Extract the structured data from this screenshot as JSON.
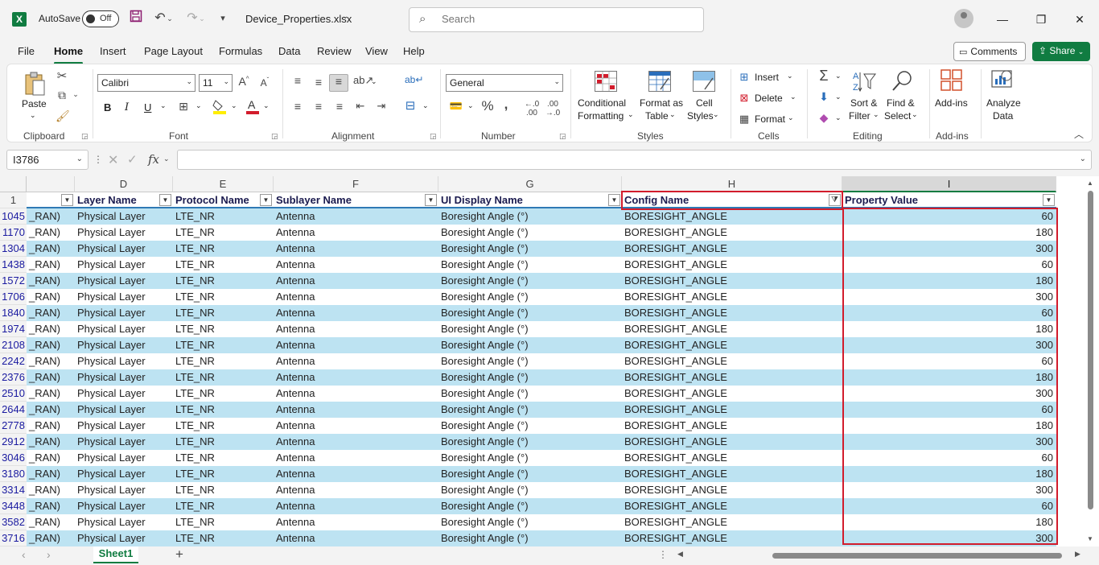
{
  "titlebar": {
    "app_logo": "X",
    "autosave_label": "AutoSave",
    "autosave_state": "Off",
    "filename": "Device_Properties.xlsx",
    "search_placeholder": "Search",
    "icons": [
      "save-icon",
      "undo-icon",
      "redo-icon",
      "customize-qat-icon",
      "account-icon",
      "minimize-icon",
      "maximize-icon",
      "close-icon"
    ]
  },
  "menu": {
    "tabs": [
      "File",
      "Home",
      "Insert",
      "Page Layout",
      "Formulas",
      "Data",
      "Review",
      "View",
      "Help"
    ],
    "active_tab": "Home",
    "comments_label": "Comments",
    "share_label": "Share"
  },
  "ribbon": {
    "clipboard": {
      "paste": "Paste",
      "label": "Clipboard"
    },
    "font": {
      "name": "Calibri",
      "size": "11",
      "label": "Font",
      "bold": "B",
      "italic": "I",
      "underline": "U"
    },
    "alignment": {
      "label": "Alignment"
    },
    "number": {
      "format": "General",
      "label": "Number"
    },
    "styles": {
      "cond1": "Conditional",
      "cond2": "Formatting",
      "fmt1": "Format as",
      "fmt2": "Table",
      "cell1": "Cell",
      "cell2": "Styles",
      "label": "Styles"
    },
    "cells": {
      "insert": "Insert",
      "delete": "Delete",
      "format": "Format",
      "label": "Cells"
    },
    "editing": {
      "sort1": "Sort &",
      "sort2": "Filter",
      "find1": "Find &",
      "find2": "Select",
      "label": "Editing"
    },
    "addins": {
      "addins": "Add-ins",
      "label": "Add-ins"
    },
    "analyze": {
      "a1": "Analyze",
      "a2": "Data"
    }
  },
  "formula_bar": {
    "name_box": "I3786",
    "formula": ""
  },
  "colors": {
    "accent": "#107c41",
    "band": "#bde3f2",
    "highlight": "#d21c2c",
    "row_number": "#1a1aa0"
  },
  "columns": {
    "letters": [
      "D",
      "E",
      "F",
      "G",
      "H",
      "I"
    ],
    "headers": [
      "",
      "Layer Name",
      "Protocol Name",
      "Sublayer Name",
      "UI Display Name",
      "Config Name",
      "Property Value"
    ]
  },
  "header_row_number": "1",
  "rows": [
    {
      "n": "1045",
      "c": [
        "_RAN)",
        "Physical Layer",
        "LTE_NR",
        "Antenna",
        "Boresight Angle (°)",
        "BORESIGHT_ANGLE",
        "60"
      ]
    },
    {
      "n": "1170",
      "c": [
        "_RAN)",
        "Physical Layer",
        "LTE_NR",
        "Antenna",
        "Boresight Angle (°)",
        "BORESIGHT_ANGLE",
        "180"
      ]
    },
    {
      "n": "1304",
      "c": [
        "_RAN)",
        "Physical Layer",
        "LTE_NR",
        "Antenna",
        "Boresight Angle (°)",
        "BORESIGHT_ANGLE",
        "300"
      ]
    },
    {
      "n": "1438",
      "c": [
        "_RAN)",
        "Physical Layer",
        "LTE_NR",
        "Antenna",
        "Boresight Angle (°)",
        "BORESIGHT_ANGLE",
        "60"
      ]
    },
    {
      "n": "1572",
      "c": [
        "_RAN)",
        "Physical Layer",
        "LTE_NR",
        "Antenna",
        "Boresight Angle (°)",
        "BORESIGHT_ANGLE",
        "180"
      ]
    },
    {
      "n": "1706",
      "c": [
        "_RAN)",
        "Physical Layer",
        "LTE_NR",
        "Antenna",
        "Boresight Angle (°)",
        "BORESIGHT_ANGLE",
        "300"
      ]
    },
    {
      "n": "1840",
      "c": [
        "_RAN)",
        "Physical Layer",
        "LTE_NR",
        "Antenna",
        "Boresight Angle (°)",
        "BORESIGHT_ANGLE",
        "60"
      ]
    },
    {
      "n": "1974",
      "c": [
        "_RAN)",
        "Physical Layer",
        "LTE_NR",
        "Antenna",
        "Boresight Angle (°)",
        "BORESIGHT_ANGLE",
        "180"
      ]
    },
    {
      "n": "2108",
      "c": [
        "_RAN)",
        "Physical Layer",
        "LTE_NR",
        "Antenna",
        "Boresight Angle (°)",
        "BORESIGHT_ANGLE",
        "300"
      ]
    },
    {
      "n": "2242",
      "c": [
        "_RAN)",
        "Physical Layer",
        "LTE_NR",
        "Antenna",
        "Boresight Angle (°)",
        "BORESIGHT_ANGLE",
        "60"
      ]
    },
    {
      "n": "2376",
      "c": [
        "_RAN)",
        "Physical Layer",
        "LTE_NR",
        "Antenna",
        "Boresight Angle (°)",
        "BORESIGHT_ANGLE",
        "180"
      ]
    },
    {
      "n": "2510",
      "c": [
        "_RAN)",
        "Physical Layer",
        "LTE_NR",
        "Antenna",
        "Boresight Angle (°)",
        "BORESIGHT_ANGLE",
        "300"
      ]
    },
    {
      "n": "2644",
      "c": [
        "_RAN)",
        "Physical Layer",
        "LTE_NR",
        "Antenna",
        "Boresight Angle (°)",
        "BORESIGHT_ANGLE",
        "60"
      ]
    },
    {
      "n": "2778",
      "c": [
        "_RAN)",
        "Physical Layer",
        "LTE_NR",
        "Antenna",
        "Boresight Angle (°)",
        "BORESIGHT_ANGLE",
        "180"
      ]
    },
    {
      "n": "2912",
      "c": [
        "_RAN)",
        "Physical Layer",
        "LTE_NR",
        "Antenna",
        "Boresight Angle (°)",
        "BORESIGHT_ANGLE",
        "300"
      ]
    },
    {
      "n": "3046",
      "c": [
        "_RAN)",
        "Physical Layer",
        "LTE_NR",
        "Antenna",
        "Boresight Angle (°)",
        "BORESIGHT_ANGLE",
        "60"
      ]
    },
    {
      "n": "3180",
      "c": [
        "_RAN)",
        "Physical Layer",
        "LTE_NR",
        "Antenna",
        "Boresight Angle (°)",
        "BORESIGHT_ANGLE",
        "180"
      ]
    },
    {
      "n": "3314",
      "c": [
        "_RAN)",
        "Physical Layer",
        "LTE_NR",
        "Antenna",
        "Boresight Angle (°)",
        "BORESIGHT_ANGLE",
        "300"
      ]
    },
    {
      "n": "3448",
      "c": [
        "_RAN)",
        "Physical Layer",
        "LTE_NR",
        "Antenna",
        "Boresight Angle (°)",
        "BORESIGHT_ANGLE",
        "60"
      ]
    },
    {
      "n": "3582",
      "c": [
        "_RAN)",
        "Physical Layer",
        "LTE_NR",
        "Antenna",
        "Boresight Angle (°)",
        "BORESIGHT_ANGLE",
        "180"
      ]
    },
    {
      "n": "3716",
      "c": [
        "_RAN)",
        "Physical Layer",
        "LTE_NR",
        "Antenna",
        "Boresight Angle (°)",
        "BORESIGHT_ANGLE",
        "300"
      ]
    }
  ],
  "sheet": {
    "tab": "Sheet1",
    "add_icon": "plus-icon"
  }
}
